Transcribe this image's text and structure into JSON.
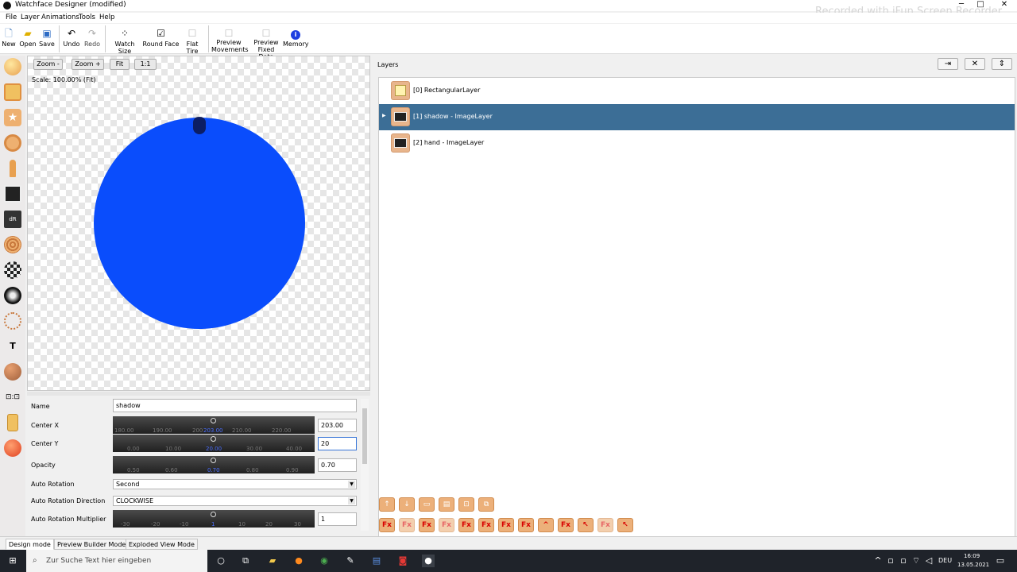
{
  "window": {
    "title": "Watchface Designer (modified)",
    "watermark": "Recorded with iFun Screen Recorder",
    "controls": [
      "─",
      "□",
      "✕"
    ]
  },
  "menu": [
    "File",
    "Layer",
    "Animations",
    "Tools",
    "Help"
  ],
  "toolbar": {
    "new": "New",
    "open": "Open",
    "save": "Save",
    "undo": "Undo",
    "redo": "Redo",
    "watch_size": "Watch Size",
    "round_face": "Round Face",
    "flat_tire": "Flat Tire",
    "preview_movements_1": "Preview",
    "preview_movements_2": "Movements",
    "preview_fixed_1": "Preview",
    "preview_fixed_2": "Fixed Data",
    "memory": "Memory"
  },
  "canvas": {
    "zoom_minus": "Zoom -",
    "zoom_plus": "Zoom +",
    "fit": "Fit",
    "one_to_one": "1:1",
    "scale_label": "Scale: 100.00% (Fit)",
    "face_color": "#0a4dfc"
  },
  "properties": {
    "name_label": "Name",
    "name_value": "shadow",
    "center_x_label": "Center X",
    "center_x_value": "203.00",
    "center_x_ticks": [
      "180.00",
      "190.00",
      "200",
      "210.00",
      "220.00"
    ],
    "center_x_selected": "203.00",
    "center_y_label": "Center Y",
    "center_y_value": "20",
    "center_y_ticks": [
      "0.00",
      "10.00",
      "30.00",
      "40.00"
    ],
    "center_y_selected": "20.00",
    "opacity_label": "Opacity",
    "opacity_value": "0.70",
    "opacity_ticks": [
      "0.50",
      "0.60",
      "0.80",
      "0.90"
    ],
    "opacity_selected": "0.70",
    "auto_rotation_label": "Auto Rotation",
    "auto_rotation_value": "Second",
    "auto_rotation_dir_label": "Auto Rotation Direction",
    "auto_rotation_dir_value": "CLOCKWISE",
    "auto_rotation_mult_label": "Auto Rotation Multiplier",
    "auto_rotation_mult_value": "1",
    "mult_ticks": [
      "-30",
      "-20",
      "-10",
      "10",
      "20",
      "30"
    ],
    "mult_selected": "1"
  },
  "layers": {
    "header": "Layers",
    "items": [
      {
        "label": "[0] RectangularLayer"
      },
      {
        "label": "[1] shadow - ImageLayer"
      },
      {
        "label": "[2] hand - ImageLayer"
      }
    ],
    "selected_color": "#3c6e96"
  },
  "modes": [
    "Design mode",
    "Preview Builder Mode",
    "Exploded View Mode"
  ],
  "taskbar": {
    "search_placeholder": "Zur Suche Text hier eingeben",
    "lang": "DEU",
    "time": "16:09",
    "date": "13.05.2021"
  }
}
